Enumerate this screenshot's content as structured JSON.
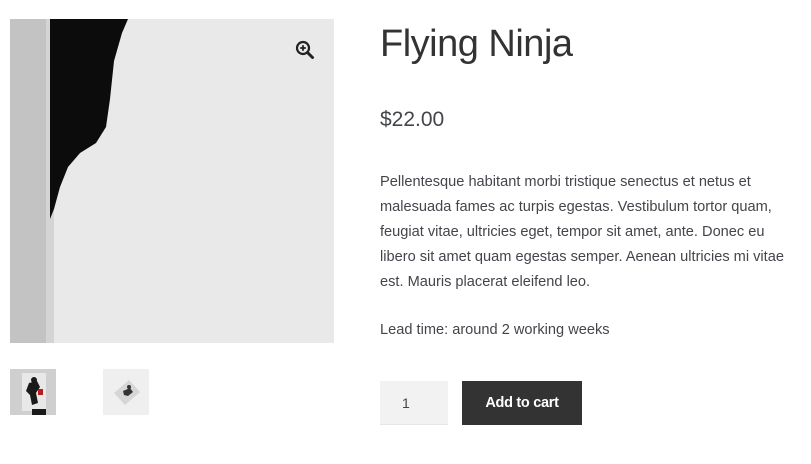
{
  "product": {
    "title": "Flying Ninja",
    "price": "$22.00",
    "description": "Pellentesque habitant morbi tristique senectus et netus et malesuada fames ac turpis egestas. Vestibulum tortor quam, feugiat vitae, ultricies eget, tempor sit amet, ante. Donec eu libero sit amet quam egestas semper. Aenean ultricies mi vitae est. Mauris placerat eleifend leo.",
    "lead_time": "Lead time: around 2 working weeks"
  },
  "gallery": {
    "zoom_icon": "zoom-in-icon",
    "thumbnails": [
      "ninja-poster-thumbnail",
      "ninja-print-thumbnail"
    ]
  },
  "cart": {
    "quantity": "1",
    "add_label": "Add to cart"
  },
  "colors": {
    "button_bg": "#333333",
    "button_text": "#ffffff",
    "text": "#43454b",
    "input_bg": "#f2f2f2"
  }
}
